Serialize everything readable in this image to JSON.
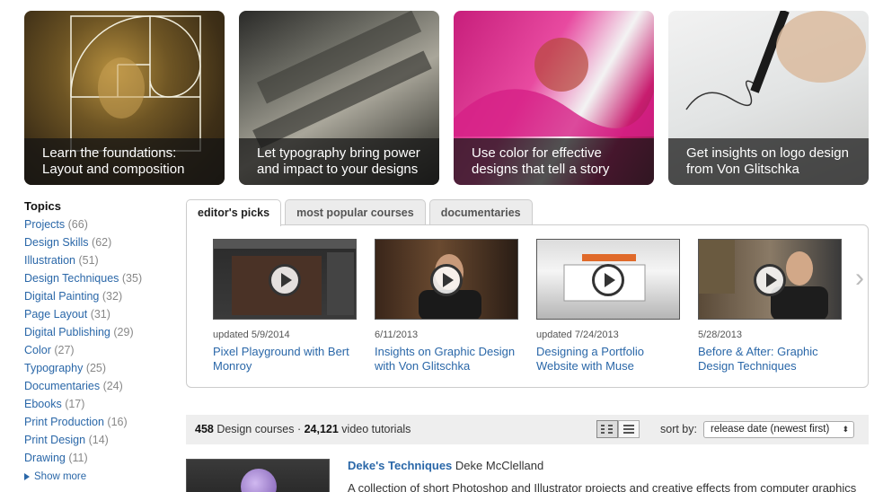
{
  "hero": [
    {
      "line1": "Learn the foundations:",
      "line2": "Layout and composition"
    },
    {
      "line1": "Let typography bring power",
      "line2": "and impact to your designs"
    },
    {
      "line1": "Use color for effective",
      "line2": "designs that tell a story"
    },
    {
      "line1": "Get insights on logo design",
      "line2": "from Von Glitschka"
    }
  ],
  "topics": {
    "heading": "Topics",
    "items": [
      {
        "label": "Projects",
        "count": "(66)"
      },
      {
        "label": "Design Skills",
        "count": "(62)"
      },
      {
        "label": "Illustration",
        "count": "(51)"
      },
      {
        "label": "Design Techniques",
        "count": "(35)"
      },
      {
        "label": "Digital Painting",
        "count": "(32)"
      },
      {
        "label": "Page Layout",
        "count": "(31)"
      },
      {
        "label": "Digital Publishing",
        "count": "(29)"
      },
      {
        "label": "Color",
        "count": "(27)"
      },
      {
        "label": "Typography",
        "count": "(25)"
      },
      {
        "label": "Documentaries",
        "count": "(24)"
      },
      {
        "label": "Ebooks",
        "count": "(17)"
      },
      {
        "label": "Print Production",
        "count": "(16)"
      },
      {
        "label": "Print Design",
        "count": "(14)"
      },
      {
        "label": "Drawing",
        "count": "(11)"
      }
    ],
    "show_more": "Show more"
  },
  "tabs": [
    "editor's picks",
    "most popular courses",
    "documentaries"
  ],
  "carousel": {
    "cards": [
      {
        "meta": "updated 5/9/2014",
        "title_1": "Pixel Playground with Bert",
        "title_2": "Monroy"
      },
      {
        "meta": "6/11/2013",
        "title_1": "Insights on Graphic Design",
        "title_2": "with Von Glitschka"
      },
      {
        "meta": "updated 7/24/2013",
        "title_1": "Designing a Portfolio",
        "title_2": "Website with Muse"
      },
      {
        "meta": "5/28/2013",
        "title_1": "Before & After: Graphic",
        "title_2": "Design Techniques"
      }
    ],
    "next_glyph": "›"
  },
  "bar": {
    "course_count": "458",
    "course_label": " Design courses · ",
    "video_count": "24,121",
    "video_label": " video tutorials",
    "sort_label": "sort by:",
    "sort_value": "release date (newest first)",
    "sort_arrow": "⬍"
  },
  "course": {
    "title": "Deke's Techniques",
    "author": " Deke McClelland",
    "description": "A collection of short Photoshop and Illustrator projects and creative effects from computer graphics"
  }
}
